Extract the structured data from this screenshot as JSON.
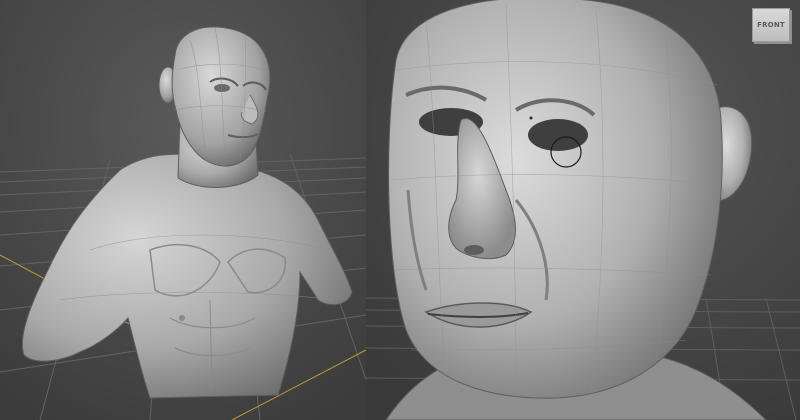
{
  "left_viewport": {
    "content": "sculpted-bust",
    "show_grid": true
  },
  "right_viewport": {
    "content": "head-closeup",
    "show_grid": true
  },
  "viewcube": {
    "label": "FRONT"
  },
  "colors": {
    "viewport_bg": "#4a4a4a",
    "grid_line": "#5c5c5c",
    "axis_line": "#b8963a",
    "model_clay": "#b9b9b9",
    "model_shadow": "#6d6d6d"
  }
}
